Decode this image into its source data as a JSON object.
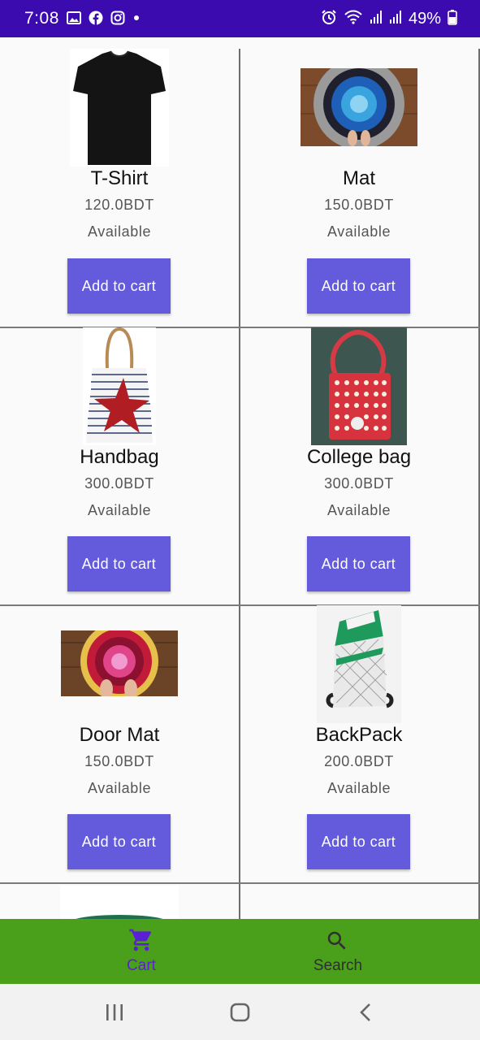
{
  "status_bar": {
    "time": "7:08",
    "battery": "49%",
    "left_icons": [
      "gallery-icon",
      "facebook-icon",
      "instagram-icon",
      "dot-icon"
    ],
    "right_icons": [
      "alarm-icon",
      "wifi-icon",
      "signal-icon",
      "signal-icon",
      "battery-icon"
    ]
  },
  "products": [
    {
      "name": "T-Shirt",
      "price": "120.0BDT",
      "availability": "Available",
      "button": "Add to cart"
    },
    {
      "name": "Mat",
      "price": "150.0BDT",
      "availability": "Available",
      "button": "Add to cart"
    },
    {
      "name": "Handbag",
      "price": "300.0BDT",
      "availability": "Available",
      "button": "Add to cart"
    },
    {
      "name": "College bag",
      "price": "300.0BDT",
      "availability": "Available",
      "button": "Add to cart"
    },
    {
      "name": "Door Mat",
      "price": "150.0BDT",
      "availability": "Available",
      "button": "Add to cart"
    },
    {
      "name": "BackPack",
      "price": "200.0BDT",
      "availability": "Available",
      "button": "Add to cart"
    }
  ],
  "bottom_nav": {
    "items": [
      {
        "label": "Cart",
        "icon": "cart-icon",
        "active": true
      },
      {
        "label": "Search",
        "icon": "search-icon",
        "active": false
      }
    ]
  },
  "colors": {
    "status_bar": "#3b0bb0",
    "button": "#635bdc",
    "bottom_nav": "#4aa01a",
    "nav_active": "#5b1fd6",
    "nav_inactive": "#333333"
  }
}
